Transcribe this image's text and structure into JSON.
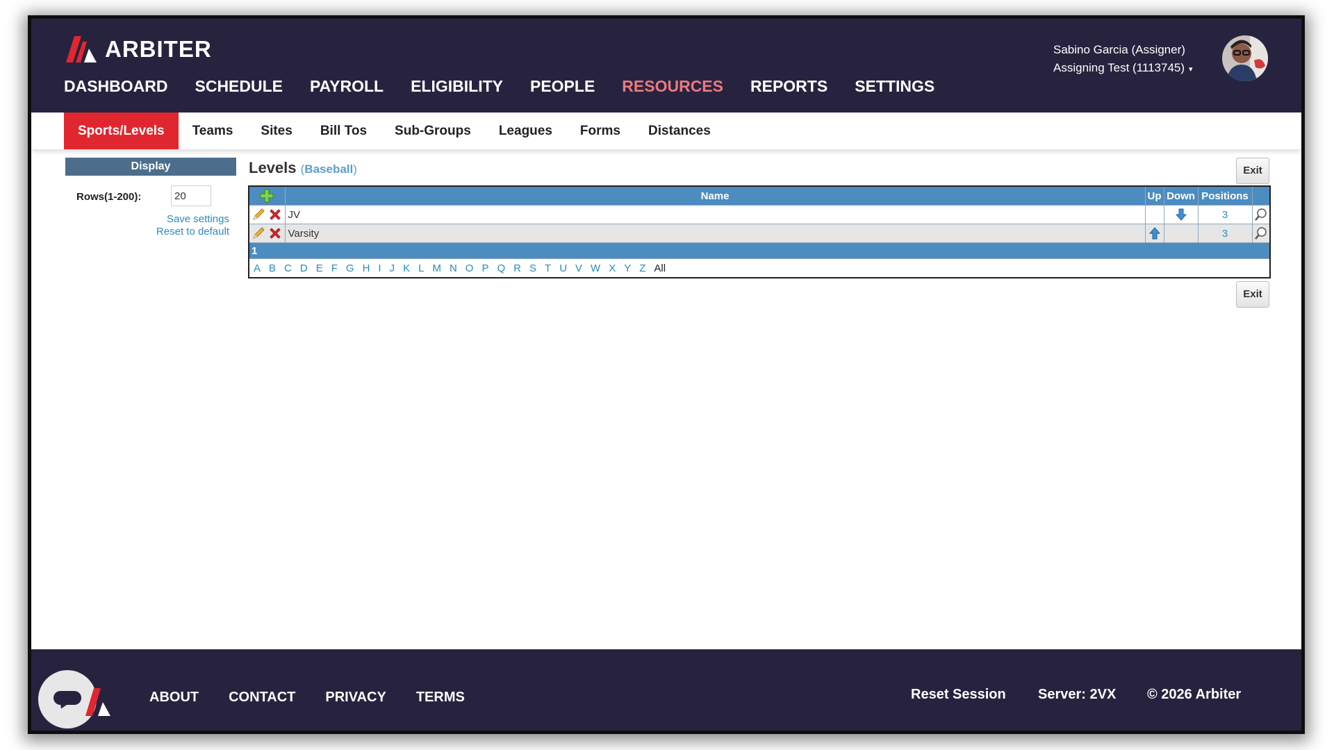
{
  "header": {
    "logo_text": "ARBITER",
    "nav": [
      "DASHBOARD",
      "SCHEDULE",
      "PAYROLL",
      "ELIGIBILITY",
      "PEOPLE",
      "RESOURCES",
      "REPORTS",
      "SETTINGS"
    ],
    "active_nav": "RESOURCES",
    "user_name": "Sabino Garcia (Assigner)",
    "account": "Assigning Test (1113745)",
    "caret": "▾"
  },
  "subnav": {
    "items": [
      "Sports/Levels",
      "Teams",
      "Sites",
      "Bill Tos",
      "Sub-Groups",
      "Leagues",
      "Forms",
      "Distances"
    ],
    "active": "Sports/Levels"
  },
  "display": {
    "header": "Display",
    "rows_label": "Rows(1-200):",
    "rows_value": "20",
    "save_settings": "Save settings",
    "reset_default": "Reset to default"
  },
  "levels": {
    "title": "Levels",
    "sport": "Baseball",
    "open_paren": "(",
    "close_paren": ")",
    "exit_label": "Exit",
    "columns": {
      "name": "Name",
      "up": "Up",
      "down": "Down",
      "positions": "Positions"
    },
    "rows": [
      {
        "name": "JV",
        "positions": "3",
        "up": false,
        "down": true
      },
      {
        "name": "Varsity",
        "positions": "3",
        "up": true,
        "down": false
      }
    ],
    "page": "1",
    "letters": [
      "A",
      "B",
      "C",
      "D",
      "E",
      "F",
      "G",
      "H",
      "I",
      "J",
      "K",
      "L",
      "M",
      "N",
      "O",
      "P",
      "Q",
      "R",
      "S",
      "T",
      "U",
      "V",
      "W",
      "X",
      "Y",
      "Z"
    ],
    "all_label": "All"
  },
  "footer": {
    "links": [
      "ABOUT",
      "CONTACT",
      "PRIVACY",
      "TERMS"
    ],
    "reset_session": "Reset Session",
    "server": "Server: 2VX",
    "copyright": "© 2026 Arbiter"
  },
  "colors": {
    "navy": "#27233f",
    "brand_red": "#e0262f",
    "active_nav": "#ec7a7d",
    "table_header": "#4d8cc1",
    "link": "#2a8bbf"
  }
}
